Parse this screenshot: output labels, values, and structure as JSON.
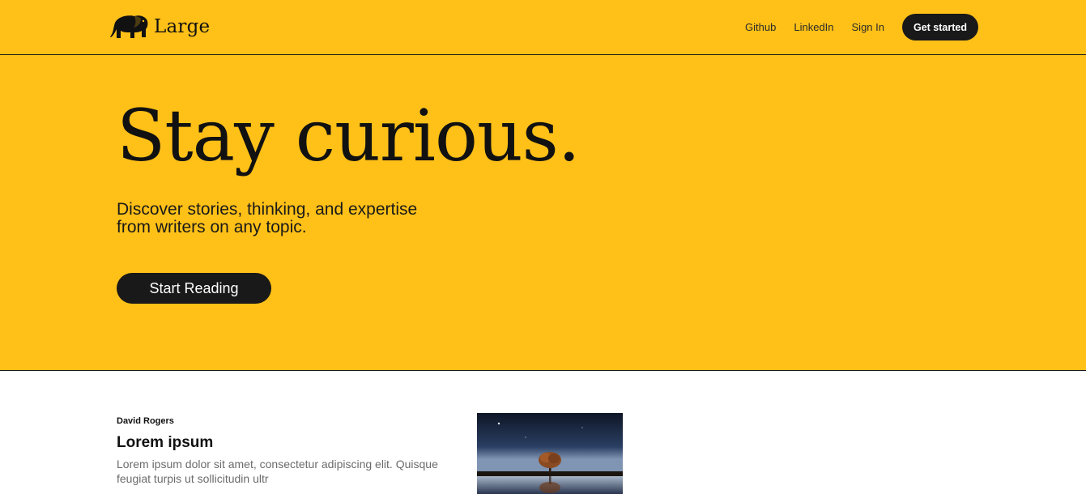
{
  "header": {
    "brand": "Large",
    "nav": [
      {
        "label": "Github"
      },
      {
        "label": "LinkedIn"
      },
      {
        "label": "Sign In"
      }
    ],
    "cta_label": "Get started"
  },
  "hero": {
    "title": "Stay curious.",
    "subtitle": "Discover stories, thinking, and expertise from writers on any topic.",
    "button_label": "Start Reading"
  },
  "article": {
    "author": "David Rogers",
    "title": "Lorem ipsum",
    "excerpt": "Lorem ipsum dolor sit amet, consectetur adipiscing elit. Quisque feugiat turpis ut sollicitudin ultr"
  },
  "icons": {
    "logo": "elephant-icon"
  },
  "colors": {
    "brand_yellow": "#FFC017",
    "dark": "#191919",
    "muted_text": "#6b6b6b"
  }
}
